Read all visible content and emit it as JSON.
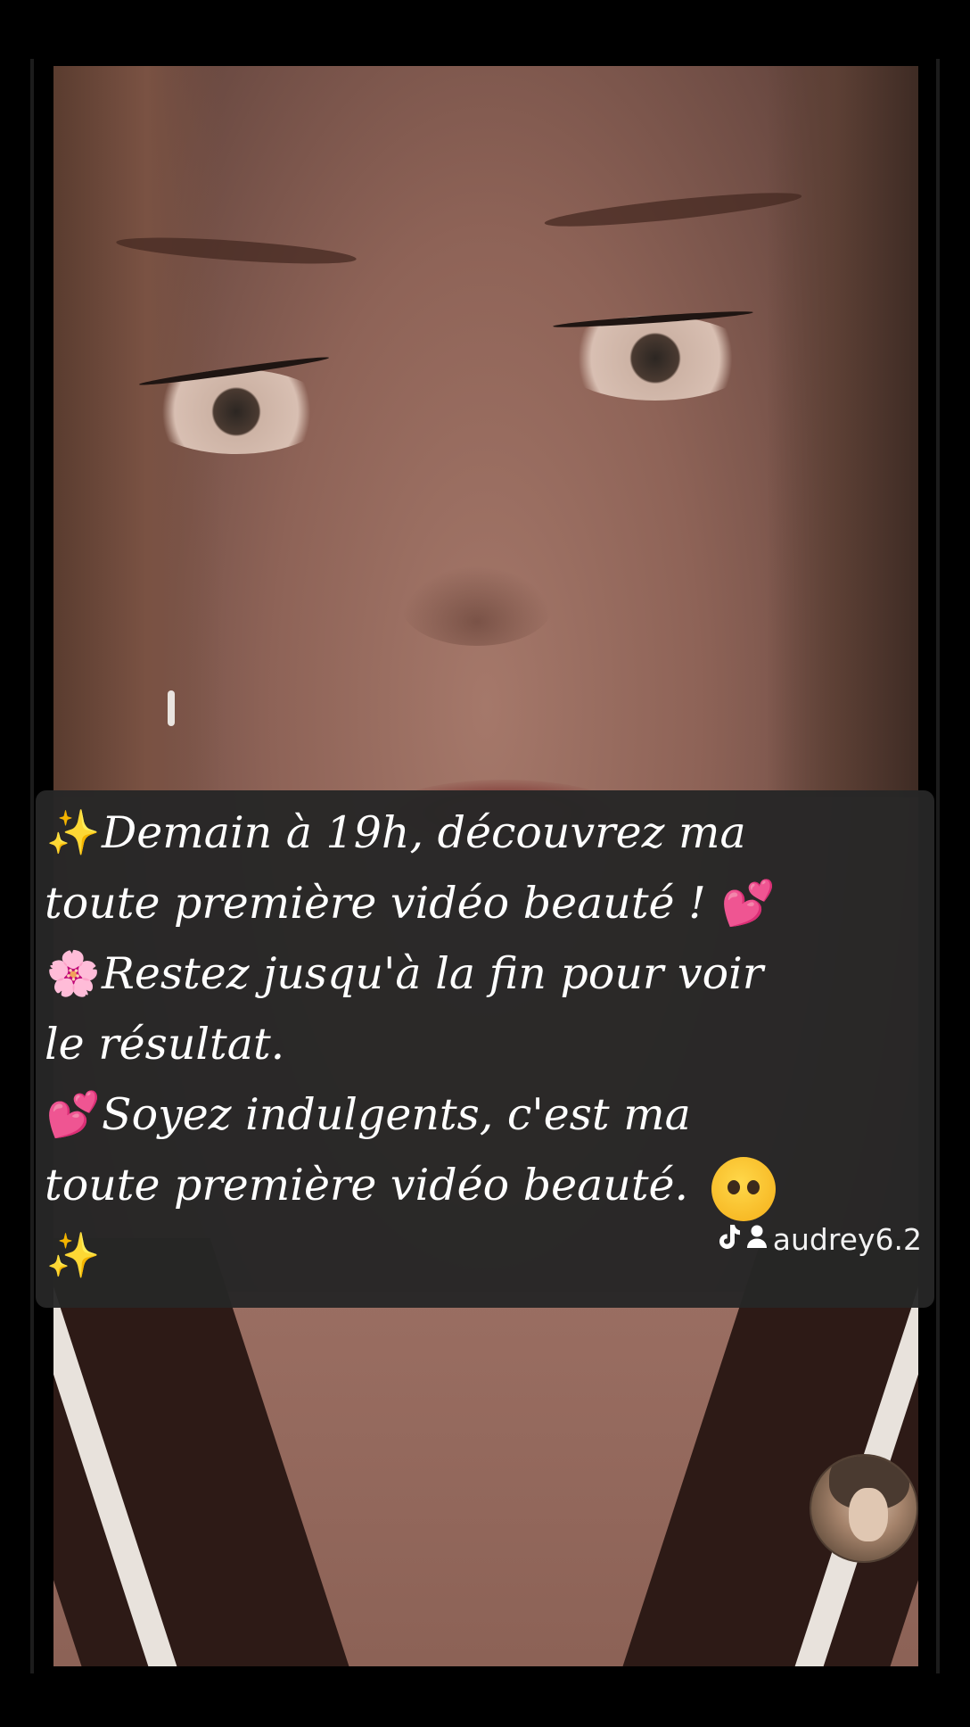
{
  "caption": {
    "lines": [
      {
        "emoji": "✨",
        "text": "Demain à 19h, découvrez ma"
      },
      {
        "emoji": "",
        "text": "toute première vidéo beauté ! ",
        "trail_emoji": "💕"
      },
      {
        "emoji": "🌸",
        "text": "Restez jusqu'à la fin pour voir"
      },
      {
        "emoji": "",
        "text": "le résultat."
      },
      {
        "emoji": "💕",
        "text": "Soyez indulgents, c'est ma"
      },
      {
        "emoji": "",
        "text": "toute première vidéo beauté. "
      },
      {
        "emoji": "✨",
        "text": ""
      }
    ]
  },
  "watermark": {
    "platform_icon": "tiktok-icon",
    "user_icon": "person-icon",
    "username": "audrey6.2"
  },
  "icons": {
    "sparkles": "sparkles-emoji",
    "hearts": "two-hearts-emoji",
    "flower": "cherry-blossom-emoji",
    "pleading": "pleading-face-emoji"
  },
  "colors": {
    "caption_background": "#262626",
    "caption_text": "#ffffff",
    "page_background": "#000000"
  }
}
